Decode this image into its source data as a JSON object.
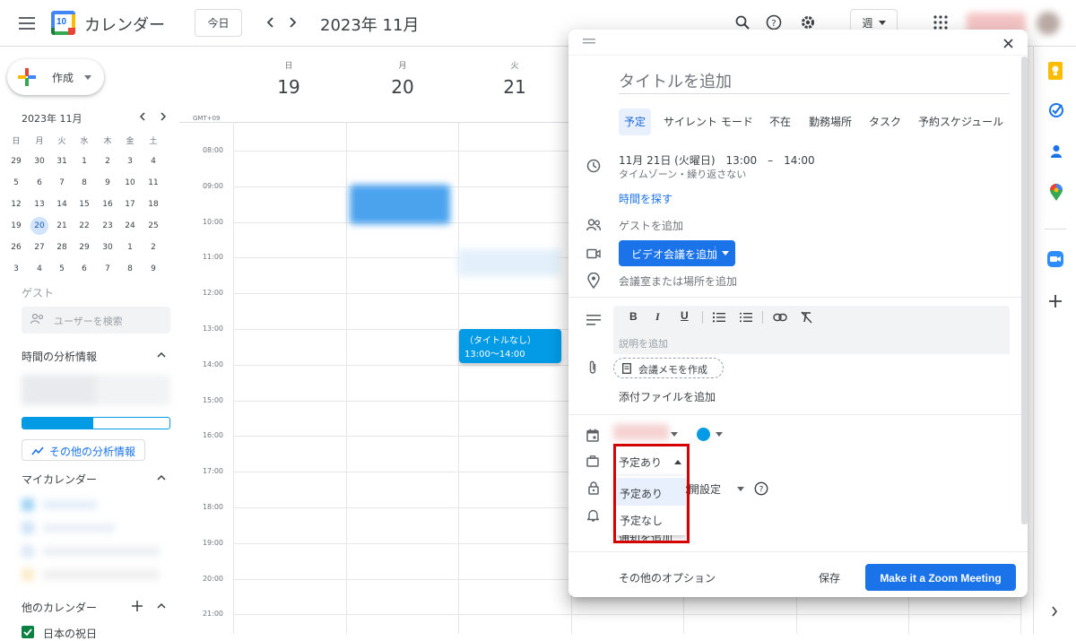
{
  "header": {
    "app_name": "カレンダー",
    "logo_day": "10",
    "today_label": "今日",
    "current_period": "2023年 11月",
    "view_label": "週"
  },
  "sidebar": {
    "create_label": "作成",
    "mini_calendar": {
      "title": "2023年 11月",
      "weekdays": [
        "日",
        "月",
        "火",
        "水",
        "木",
        "金",
        "土"
      ],
      "weeks": [
        [
          "29",
          "30",
          "31",
          "1",
          "2",
          "3",
          "4"
        ],
        [
          "5",
          "6",
          "7",
          "8",
          "9",
          "10",
          "11"
        ],
        [
          "12",
          "13",
          "14",
          "15",
          "16",
          "17",
          "18"
        ],
        [
          "19",
          "20",
          "21",
          "22",
          "23",
          "24",
          "25"
        ],
        [
          "26",
          "27",
          "28",
          "29",
          "30",
          "1",
          "2"
        ],
        [
          "3",
          "4",
          "5",
          "6",
          "7",
          "8",
          "9"
        ]
      ],
      "selected": "20"
    },
    "guests_title": "ゲスト",
    "search_users_placeholder": "ユーザーを検索",
    "time_insights_title": "時間の分析情報",
    "more_insights_label": "その他の分析情報",
    "my_calendars_title": "マイカレンダー",
    "other_calendars_title": "他のカレンダー",
    "holiday_calendar_label": "日本の祝日"
  },
  "week": {
    "timezone": "GMT+09",
    "days": [
      {
        "weekday": "日",
        "date": "19"
      },
      {
        "weekday": "月",
        "date": "20"
      },
      {
        "weekday": "火",
        "date": "21"
      }
    ],
    "hours": [
      "08:00",
      "09:00",
      "10:00",
      "11:00",
      "12:00",
      "13:00",
      "14:00",
      "15:00",
      "16:00",
      "17:00",
      "18:00",
      "19:00",
      "20:00",
      "21:00"
    ],
    "event": {
      "title": "（タイトルなし）",
      "time": "13:00～14:00",
      "color": "#039be5"
    }
  },
  "dialog": {
    "title_placeholder": "タイトルを追加",
    "tabs": [
      "予定",
      "サイレント モード",
      "不在",
      "勤務場所",
      "タスク",
      "予約スケジュール"
    ],
    "active_tab": "予定",
    "datetime": "11月 21日 (火曜日)　13:00　–　14:00",
    "timezone_repeat": "タイムゾーン・繰り返さない",
    "find_time": "時間を探す",
    "add_guests": "ゲストを追加",
    "video_button": "ビデオ会議を追加",
    "location_placeholder": "会議室または場所を追加",
    "description_placeholder": "説明を追加",
    "meeting_notes_button": "会議メモを作成",
    "add_attachment": "添付ファイルを追加",
    "calendar_color": "#039be5",
    "busy_select_value": "予定あり",
    "busy_options": [
      "予定あり",
      "予定なし"
    ],
    "visibility_value": "公開設定",
    "notification_label": "通知を追加",
    "more_options": "その他のオプション",
    "save": "保存",
    "zoom_button": "Make it a Zoom Meeting",
    "highlight_color": "#d50000"
  }
}
